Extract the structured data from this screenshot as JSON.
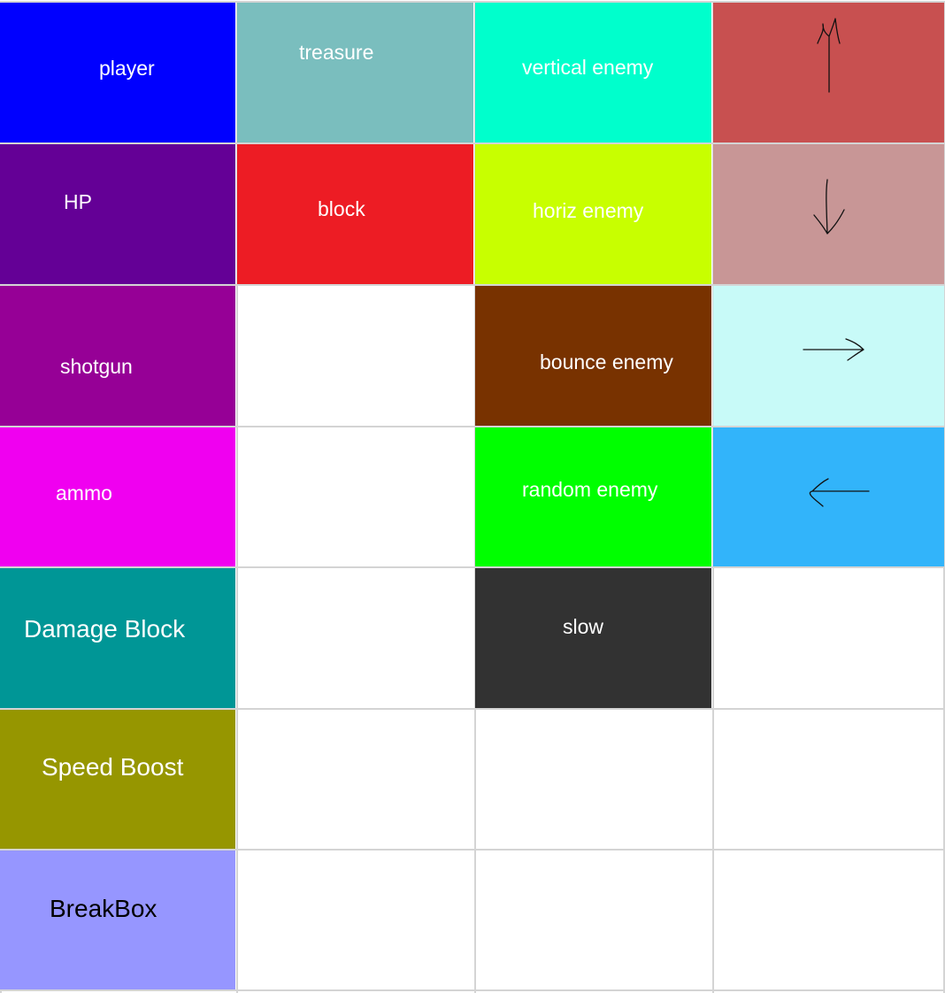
{
  "tiles": [
    {
      "key": "player",
      "label": "player",
      "color": "#0000FF",
      "text_color": "#FFFFFF"
    },
    {
      "key": "treasure",
      "label": "treasure",
      "color": "#7ABEBE",
      "text_color": "#FFFFFF"
    },
    {
      "key": "vertical_enemy",
      "label": "vertical enemy",
      "color": "#00FFCC",
      "text_color": "#FFFFFF"
    },
    {
      "key": "arrow_up",
      "label": "",
      "color": "#C85050",
      "icon": "arrow-up-icon"
    },
    {
      "key": "hp",
      "label": "HP",
      "color": "#640096",
      "text_color": "#FFFFFF"
    },
    {
      "key": "block",
      "label": "block",
      "color": "#ED1C24",
      "text_color": "#FFFFFF"
    },
    {
      "key": "horiz_enemy",
      "label": "horiz enemy",
      "color": "#C8FF00",
      "text_color": "#FFFFFF"
    },
    {
      "key": "arrow_down",
      "label": "",
      "color": "#C89696",
      "icon": "arrow-down-icon"
    },
    {
      "key": "shotgun",
      "label": "shotgun",
      "color": "#960096",
      "text_color": "#FFFFFF"
    },
    {
      "key": "bounce_enemy",
      "label": "bounce enemy",
      "color": "#783200",
      "text_color": "#FFFFFF"
    },
    {
      "key": "arrow_right",
      "label": "",
      "color": "#C8FAF8",
      "icon": "arrow-right-icon"
    },
    {
      "key": "ammo",
      "label": "ammo",
      "color": "#F000F0",
      "text_color": "#FFFFFF"
    },
    {
      "key": "random_enemy",
      "label": "random enemy",
      "color": "#00FF00",
      "text_color": "#FFFFFF"
    },
    {
      "key": "arrow_left",
      "label": "",
      "color": "#32B4FA",
      "icon": "arrow-left-icon"
    },
    {
      "key": "damage_block",
      "label": "Damage Block",
      "color": "#009696",
      "text_color": "#FFFFFF"
    },
    {
      "key": "slow",
      "label": "slow",
      "color": "#323232",
      "text_color": "#FFFFFF"
    },
    {
      "key": "speed_boost",
      "label": "Speed Boost",
      "color": "#969600",
      "text_color": "#FFFFFF"
    },
    {
      "key": "breakbox",
      "label": "BreakBox",
      "color": "#9696FF",
      "text_color": "#000000"
    }
  ]
}
